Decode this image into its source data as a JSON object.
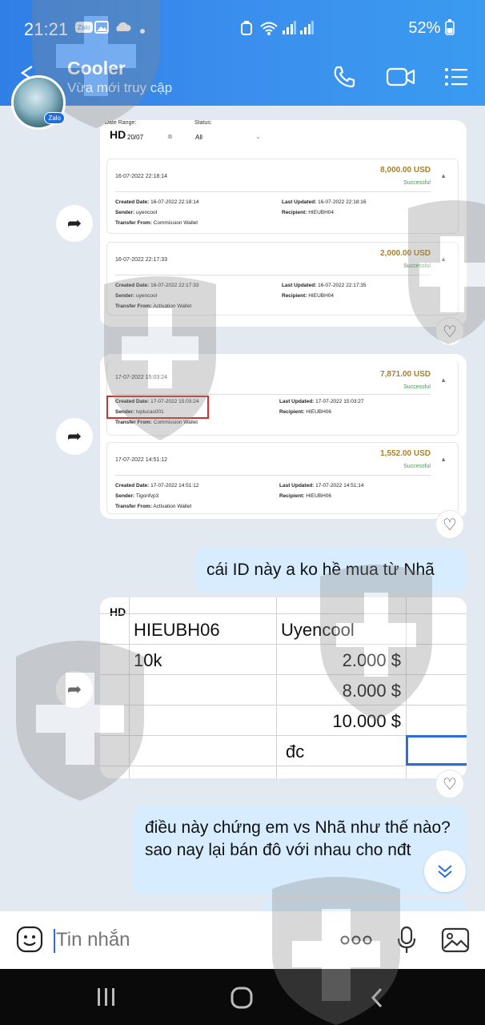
{
  "status_bar": {
    "time": "21:21",
    "battery": "52%"
  },
  "header": {
    "title": "Cooler",
    "subtitle": "Vừa mới truy cập",
    "zalo_badge": "Zalo"
  },
  "screenshot1": {
    "hd": "HD",
    "filter": {
      "date_label": "Date Range:",
      "date_value": "20/07",
      "status_label": "Status:",
      "status_value": "All"
    },
    "transactions": [
      {
        "date": "16-07-2022 22:18:14",
        "amount": "8,000.00 USD",
        "status": "Successful",
        "created": "16-07-2022 22:18:14",
        "sender": "uyencool",
        "transfer_from": "Commission Wallet",
        "updated": "16-07-2022 22:18:16",
        "recipient": "HIEUBH04"
      },
      {
        "date": "16-07-2022 22:17:33",
        "amount": "2,000.00 USD",
        "status": "Successful",
        "created": "16-07-2022 22:17:33",
        "sender": "uyencool",
        "transfer_from": "Activation Wallet",
        "updated": "16-07-2022 22:17:35",
        "recipient": "HIEUBH04"
      }
    ]
  },
  "screenshot2": {
    "hd": "HD",
    "transactions": [
      {
        "date": "17-07-2022 15:03:24",
        "amount": "7,871.00 USD",
        "status": "Successful",
        "created": "17-07-2022 15:03:24",
        "sender": "tvplucas001",
        "transfer_from": "Commission Wallet",
        "updated": "17-07-2022 15:03:27",
        "recipient": "HIEUBH06"
      },
      {
        "date": "17-07-2022 14:51:12",
        "amount": "1,552.00 USD",
        "status": "Successful",
        "created": "17-07-2022 14:51:12",
        "sender": "Tigonfvp3",
        "transfer_from": "Activation Wallet",
        "updated": "17-07-2022 14:51:14",
        "recipient": "HIEUBH06"
      }
    ]
  },
  "labels": {
    "created": "Created Date:",
    "sender": "Sender:",
    "transfer_from": "Transfer From:",
    "updated": "Last Updated:",
    "recipient": "Recipient:"
  },
  "message1": "cái ID này a ko hề mua từ Nhã",
  "sheet": {
    "hd": "HD",
    "r1c1": "HIEUBH06",
    "r1c2": "Uyencool",
    "r2c1": "10k",
    "r2c2": "2.000 $",
    "r3c2": "8.000 $",
    "r4c2": "10.000 $",
    "r5c2": "đc"
  },
  "message2": "điều này chứng em vs Nhã như thế nào? sao nay lại bán đô với nhau cho nđt",
  "input": {
    "placeholder": "Tin nhắn"
  },
  "colors": {
    "header": "#3b90ee",
    "bubble": "#d7ecfe",
    "amount": "#a6822a",
    "success": "#3aa34a"
  }
}
